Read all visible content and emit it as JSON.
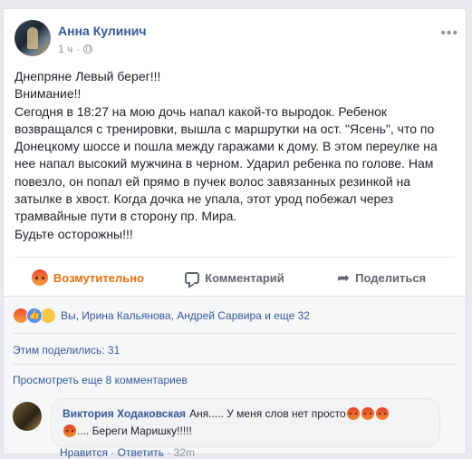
{
  "post": {
    "author": "Анна Кулинич",
    "time": "1 ч",
    "privacy_icon": "globe-icon",
    "more_icon": "more-icon",
    "lines": [
      "Днепряне Левый берег!!!",
      "Внимание!!",
      "Сегодня в 18:27 на мою дочь напал какой-то выродок. Ребенок возвращался с тренировки, вышла с маршрутки на ост. \"Ясень\", что по Донецкому шоссе и пошла между гаражами к дому. В этом переулке на нее напал высокий мужчина в черном. Ударил ребенка по голове. Нам повезло, он попал ей прямо в пучек волос завязанных резинкой на затылке в хвост. Когда дочка не упала, этот урод побежал через трамвайные пути в сторону пр. Мира.",
      "Будьте осторожны!!!"
    ]
  },
  "actions": {
    "react_label": "Возмутительно",
    "comment_label": "Комментарий",
    "share_label": "Поделиться",
    "react_color": "#e9710f"
  },
  "footer": {
    "reactions_text": "Вы, Ирина Кальянова, Андрей Сарвира и еще 32",
    "shares_text": "Этим поделились: 31",
    "view_more": "Просмотреть еще 8 комментариев"
  },
  "comment": {
    "author": "Виктория Ходаковская",
    "text": "Аня..... У меня слов нет просто",
    "text2": ".... Береги Маришку!!!!!",
    "like_label": "Нравится",
    "reply_label": "Ответить",
    "time": "32m",
    "sep": "·"
  },
  "colors": {
    "link": "#365899",
    "muted": "#90949c"
  }
}
